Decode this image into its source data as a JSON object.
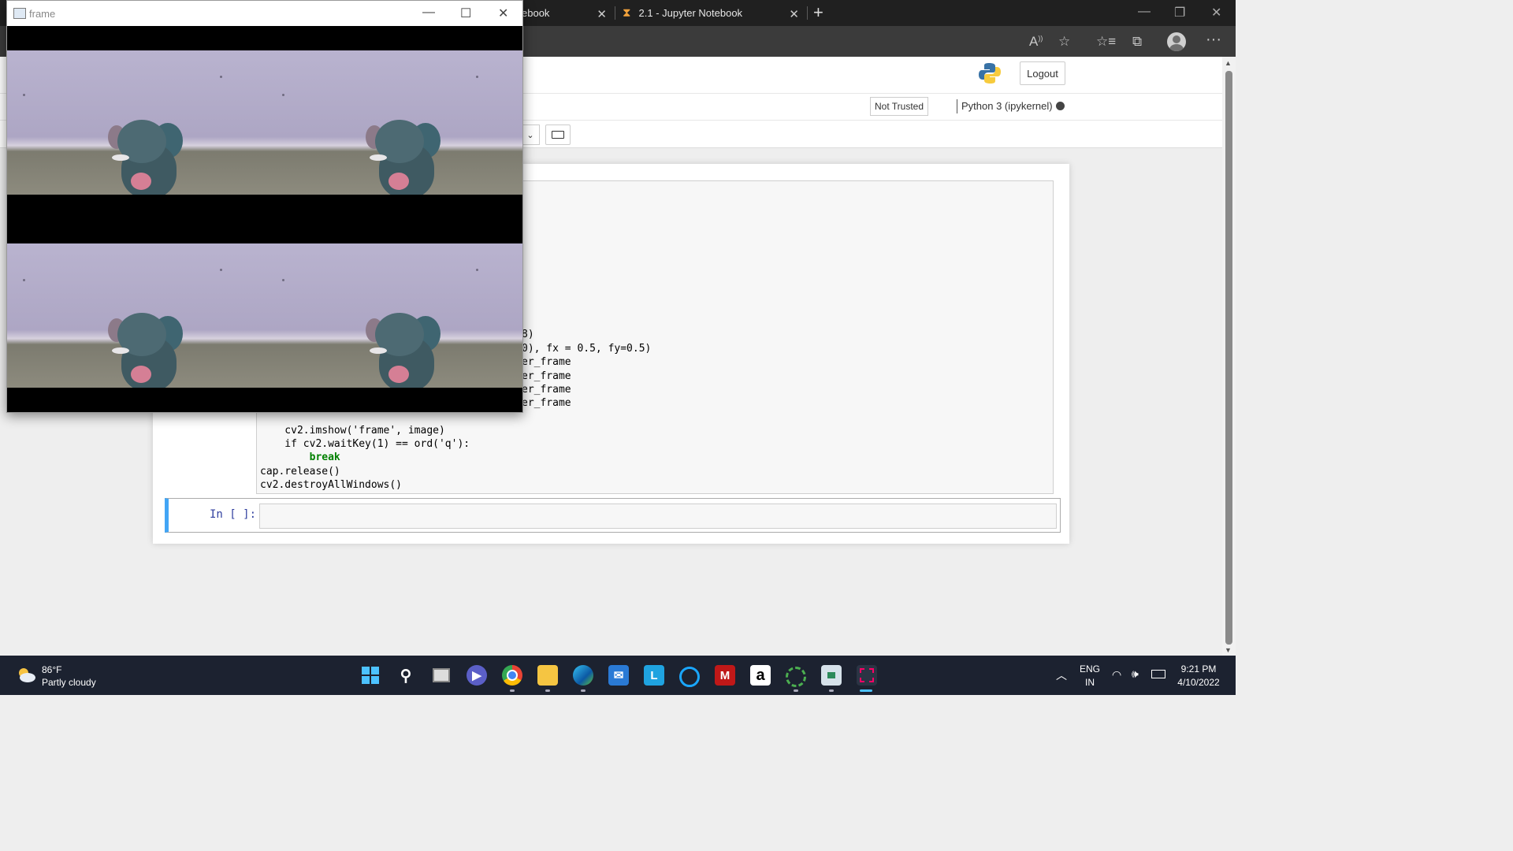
{
  "browser": {
    "tabs": [
      {
        "title": "ebook"
      },
      {
        "title": "2.1 - Jupyter Notebook"
      }
    ]
  },
  "jupyter": {
    "logout_label": "Logout",
    "trust_label": "Not Trusted",
    "kernel_label": "Python 3 (ipykernel)",
    "code_lines_partial": [
      "8)",
      "0), fx = 0.5, fy=0.5)",
      "er_frame",
      "er_frame",
      "er_frame",
      "er_frame"
    ],
    "code_lines": [
      "    cv2.imshow('frame', image)",
      "    if cv2.waitKey(1) == ord('q'):",
      "        break",
      "cap.release()",
      "cv2.destroyAllWindows()"
    ],
    "next_prompt": "In [ ]:"
  },
  "cv_window": {
    "title": "frame"
  },
  "taskbar": {
    "weather_temp": "86°F",
    "weather_desc": "Partly cloudy",
    "lang_top": "ENG",
    "lang_bottom": "IN",
    "time": "9:21 PM",
    "date": "4/10/2022"
  }
}
